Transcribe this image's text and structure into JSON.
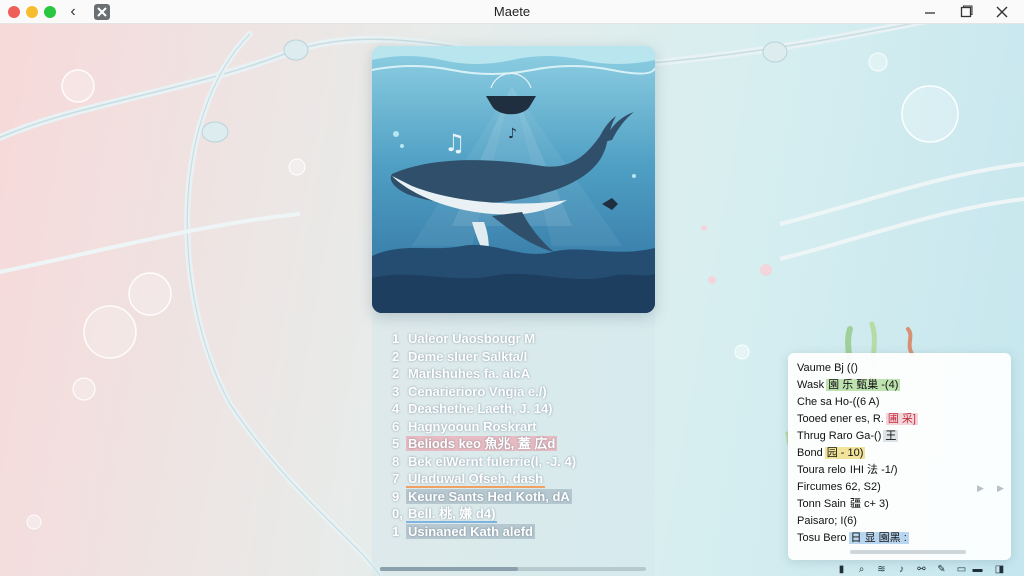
{
  "window": {
    "title": "Maete",
    "back_glyph": "‹"
  },
  "colors": {
    "traffic_close": "#ef5f57",
    "traffic_minimize": "#f6bd2f",
    "traffic_maximize": "#29c840",
    "highlight_pink": "#f096a0",
    "note_tag_green": "#bfe3b0",
    "note_tag_red": "#c03040"
  },
  "tracks": [
    {
      "num": "1",
      "label": "Ualeor Uaosbougr M",
      "style": ""
    },
    {
      "num": "2",
      "label": "Deme sluer Salkta/I",
      "style": ""
    },
    {
      "num": "2",
      "label": "Marlshuhes fa. alcA",
      "style": ""
    },
    {
      "num": "3",
      "label": "Cenarierioro Vngia e./)",
      "style": ""
    },
    {
      "num": "4",
      "label": "Deashethe Laeth, J. 14)",
      "style": ""
    },
    {
      "num": "6",
      "label": "Hagnyooun Roskrart",
      "style": ""
    },
    {
      "num": "5",
      "label": "Beliods keo 魚兆, 蓋 広d",
      "style": "hl-pink"
    },
    {
      "num": "8",
      "label": "Bek elWernt fulerrie(l, -J. 4)",
      "style": ""
    },
    {
      "num": "7",
      "label": "Uladuwal Ofseh, dash",
      "style": "ul-orange"
    },
    {
      "num": "9",
      "label": "Keure Sants Hed Koth, dA",
      "style": "hl-gray"
    },
    {
      "num": "0,",
      "label": "Bell. 桃, 嫌 d4)",
      "style": "ul-blue"
    },
    {
      "num": "1",
      "label": "Usinaned Kath alefd",
      "style": "hl-gray"
    }
  ],
  "player": {
    "progress": 0.52
  },
  "notes": [
    {
      "text": "Vaume Bj (()",
      "tag": "",
      "tag_style": ""
    },
    {
      "text": "Wask",
      "tag": "園 乐 甄巢 -(4)",
      "tag_style": "tag-green"
    },
    {
      "text": "Che sa Ho-((6 A)",
      "tag": "",
      "tag_style": ""
    },
    {
      "text": "Tooed ener es, R.",
      "tag": "圃 采]",
      "tag_style": "tag-red"
    },
    {
      "text": "Thrug Raro Ga-()",
      "tag": "王",
      "tag_style": "tag-gray"
    },
    {
      "text": "Bond",
      "tag": "园 - 10)",
      "tag_style": "tag-yellow"
    },
    {
      "text": "Toura relo",
      "tag": "IHI 法 -1/)",
      "tag_style": ""
    },
    {
      "text": "Fircumes 62, S2)",
      "tag": "",
      "tag_style": ""
    },
    {
      "text": "Tonn Sain",
      "tag": "疆 c+ 3)",
      "tag_style": ""
    },
    {
      "text": "Paisaro; I(6)",
      "tag": "",
      "tag_style": ""
    },
    {
      "text": "Tosu Bero",
      "tag": "日 显 園黑 :",
      "tag_style": "tag-blue"
    }
  ],
  "taskbar": {
    "icons": [
      "notification-icon",
      "search-icon",
      "settings-icon",
      "music-note-icon",
      "link-icon",
      "pen-icon",
      "folder-icon",
      "keyboard-icon",
      "display-icon"
    ],
    "glyphs": [
      "▮",
      "⌕",
      "≋",
      "♪",
      "⚯",
      "✎",
      "▭",
      "▬",
      "◨"
    ]
  }
}
